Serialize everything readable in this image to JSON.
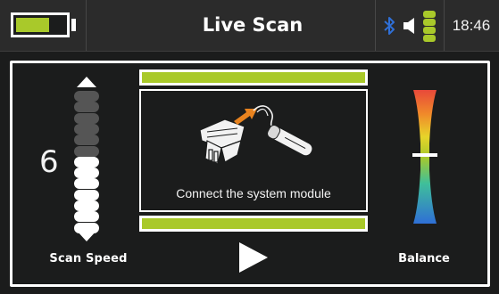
{
  "status_bar": {
    "title": "Live Scan",
    "clock": "18:46",
    "battery_level": 0.68,
    "signal_level": 4,
    "colors": {
      "accent": "#a9c92a",
      "bluetooth": "#2f6fd6"
    },
    "icons": [
      "battery-icon",
      "bluetooth-icon",
      "speaker-icon",
      "signal-icon"
    ]
  },
  "scan_speed": {
    "label": "Scan Speed",
    "value": "6",
    "segments_total": 13,
    "segments_active": 7
  },
  "center": {
    "message": "Connect the system module",
    "icons": [
      "module-illustration",
      "play-icon"
    ]
  },
  "balance": {
    "label": "Balance",
    "level": 0.5
  }
}
